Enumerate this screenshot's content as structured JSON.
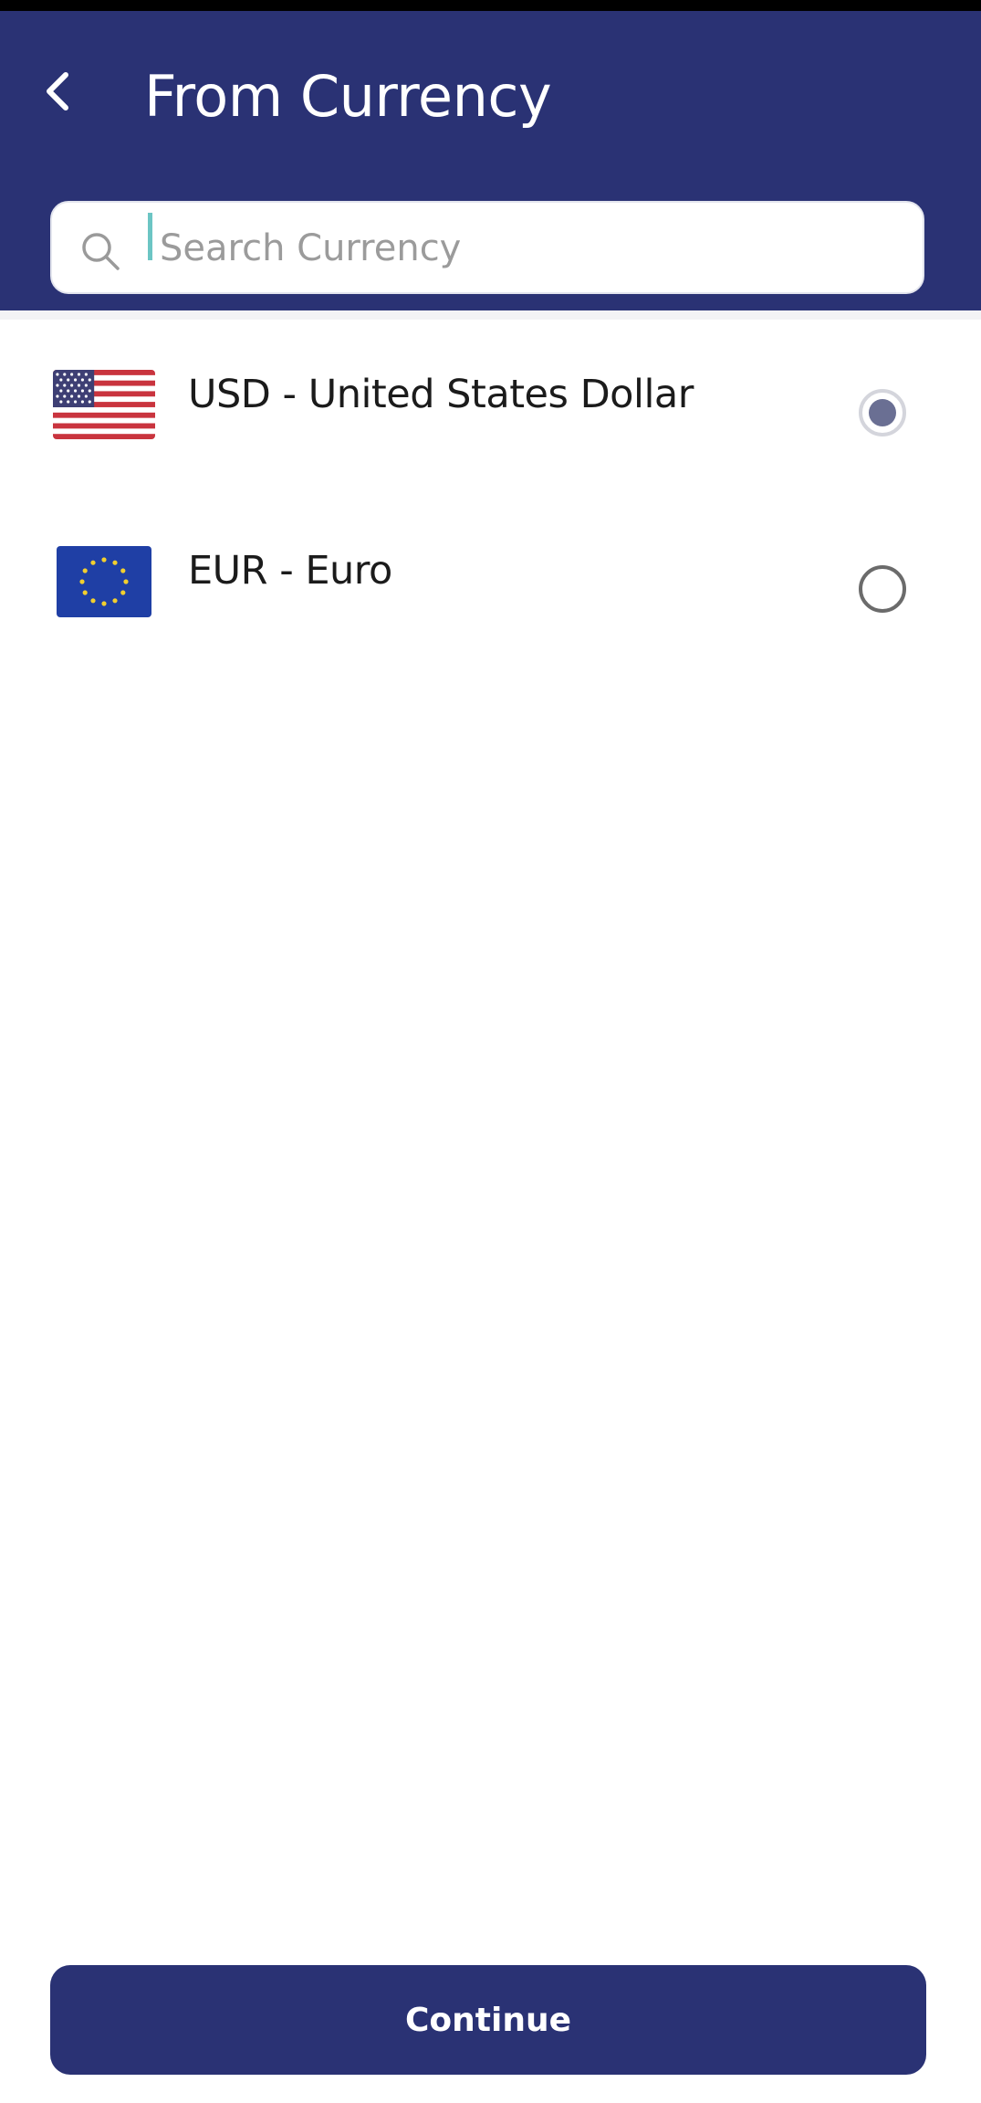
{
  "header": {
    "title": "From Currency",
    "back_icon": "chevron-left-icon"
  },
  "search": {
    "placeholder": "Search Currency",
    "value": "",
    "icon": "search-icon"
  },
  "currencies": [
    {
      "label": "USD - United States Dollar",
      "flag": "us-flag-icon",
      "selected": true
    },
    {
      "label": "EUR - Euro",
      "flag": "eu-flag-icon",
      "selected": false
    }
  ],
  "footer": {
    "continue_label": "Continue"
  },
  "colors": {
    "primary": "#2a3274",
    "cursor": "#6cc5c4",
    "radio_selected": "#6a6f93"
  }
}
